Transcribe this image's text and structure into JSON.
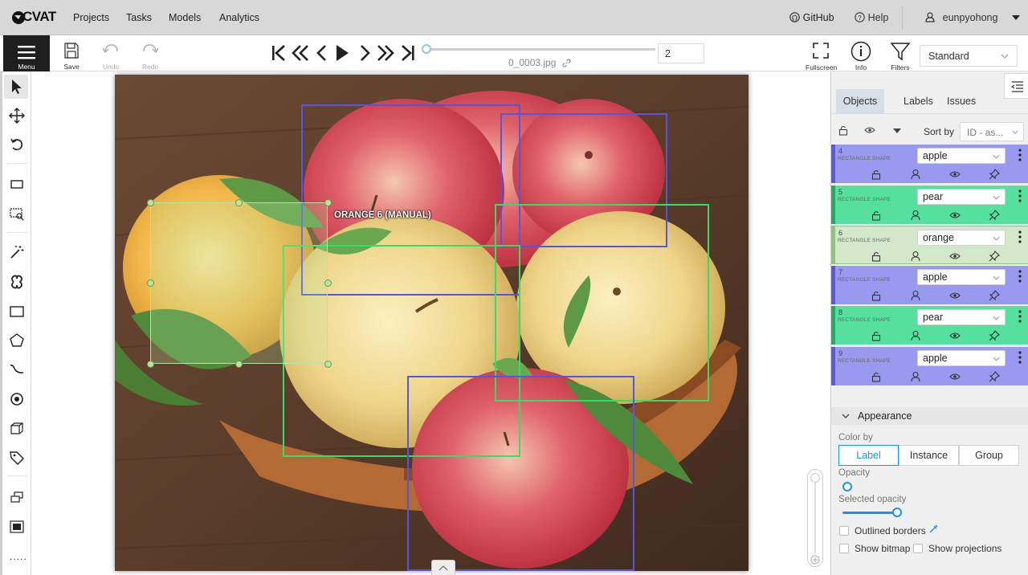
{
  "topbar": {
    "brand": "CVAT",
    "nav": [
      "Projects",
      "Tasks",
      "Models",
      "Analytics"
    ],
    "github": "GitHub",
    "help": "Help",
    "user": "eunpyohong"
  },
  "toolbar": {
    "menu_label": "Menu",
    "save_label": "Save",
    "undo_label": "Undo",
    "redo_label": "Redo",
    "frame_number": "2",
    "frame_filename": "0_0003.jpg",
    "fullscreen_label": "Fullscreen",
    "info_label": "Info",
    "filters_label": "Filters",
    "workspace": "Standard"
  },
  "canvas": {
    "selected_label": "ORANGE 6 (MANUAL)"
  },
  "objects_panel": {
    "tabs": [
      "Objects",
      "Labels",
      "Issues"
    ],
    "sort_label": "Sort by",
    "sort_value": "ID - as...",
    "items": [
      {
        "id": "4",
        "shape": "RECTANGLE SHAPE",
        "label": "apple",
        "color": "#9a99f0",
        "border": "#5b5bd6"
      },
      {
        "id": "5",
        "shape": "RECTANGLE SHAPE",
        "label": "pear",
        "color": "#55e0a0",
        "border": "#2aa86a"
      },
      {
        "id": "6",
        "shape": "RECTANGLE SHAPE",
        "label": "orange",
        "color": "#d3e8c9",
        "border": "#8fc47a"
      },
      {
        "id": "7",
        "shape": "RECTANGLE SHAPE",
        "label": "apple",
        "color": "#9a99f0",
        "border": "#5b5bd6"
      },
      {
        "id": "8",
        "shape": "RECTANGLE SHAPE",
        "label": "pear",
        "color": "#55e0a0",
        "border": "#2aa86a"
      },
      {
        "id": "9",
        "shape": "RECTANGLE SHAPE",
        "label": "apple",
        "color": "#9a99f0",
        "border": "#5b5bd6"
      }
    ]
  },
  "appearance": {
    "title": "Appearance",
    "color_by_label": "Color by",
    "color_by_options": [
      "Label",
      "Instance",
      "Group"
    ],
    "color_by_selected": "Label",
    "opacity_label": "Opacity",
    "opacity_value": 0,
    "selected_opacity_label": "Selected opacity",
    "selected_opacity_value": 0.9,
    "outlined_borders_label": "Outlined borders",
    "show_bitmap_label": "Show bitmap",
    "show_projections_label": "Show projections"
  },
  "colors": {
    "accent": "#1890ff",
    "apple_box": "#5555e0",
    "pear_box": "#33dd66",
    "orange_box": "#b8e6a0"
  }
}
